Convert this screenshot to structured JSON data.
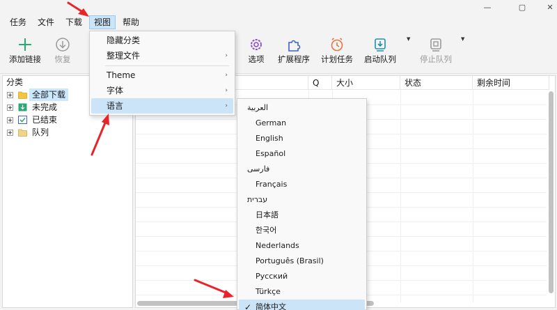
{
  "window": {
    "minimize_glyph": "—",
    "maximize_glyph": "▢",
    "close_glyph": "✕"
  },
  "menubar": {
    "items": [
      "任务",
      "文件",
      "下载",
      "视图",
      "帮助"
    ]
  },
  "toolbar": {
    "buttons": [
      {
        "label": "添加链接",
        "icon": "plus-icon"
      },
      {
        "label": "恢复",
        "icon": "download-circle-icon"
      },
      {
        "label": "选项",
        "icon": "gear-icon"
      },
      {
        "label": "扩展程序",
        "icon": "puzzle-icon"
      },
      {
        "label": "计划任务",
        "icon": "alarm-clock-icon"
      },
      {
        "label": "启动队列",
        "icon": "queue-start-icon"
      },
      {
        "label": "停止队列",
        "icon": "queue-stop-icon"
      }
    ]
  },
  "sidebar": {
    "header": "分类",
    "items": [
      {
        "label": "全部下载",
        "selected": true
      },
      {
        "label": "未完成"
      },
      {
        "label": "已结束"
      },
      {
        "label": "队列"
      }
    ]
  },
  "table": {
    "columns": [
      "Q",
      "大小",
      "状态",
      "剩余时间"
    ]
  },
  "view_menu": {
    "items": [
      {
        "label": "隐藏分类",
        "submenu": false
      },
      {
        "label": "整理文件",
        "submenu": true
      },
      {
        "label": "Theme",
        "submenu": true
      },
      {
        "label": "字体",
        "submenu": true
      },
      {
        "label": "语言",
        "submenu": true,
        "highlighted": true
      }
    ],
    "submenu_arrow": "›"
  },
  "language_menu": {
    "items": [
      {
        "label": "العربية",
        "rtl": true
      },
      {
        "label": "German"
      },
      {
        "label": "English"
      },
      {
        "label": "Español"
      },
      {
        "label": "فارسی",
        "rtl": true
      },
      {
        "label": "Français"
      },
      {
        "label": "עברית",
        "rtl": true
      },
      {
        "label": "日本語"
      },
      {
        "label": "한국어"
      },
      {
        "label": "Nederlands"
      },
      {
        "label": "Português (Brasil)"
      },
      {
        "label": "Русский"
      },
      {
        "label": "Türkçe"
      },
      {
        "label": "简体中文",
        "checked": true
      }
    ],
    "check_glyph": "✓"
  },
  "colors": {
    "accent_highlight": "#cce4f7",
    "annotation_arrow": "#e8232a",
    "add_icon_green": "#2aa876",
    "options_icon_purple": "#8a4fc9",
    "extension_icon_blue": "#3a62c8",
    "schedule_icon_orange": "#e8733c",
    "queue_icon_teal": "#1f8fb0"
  }
}
